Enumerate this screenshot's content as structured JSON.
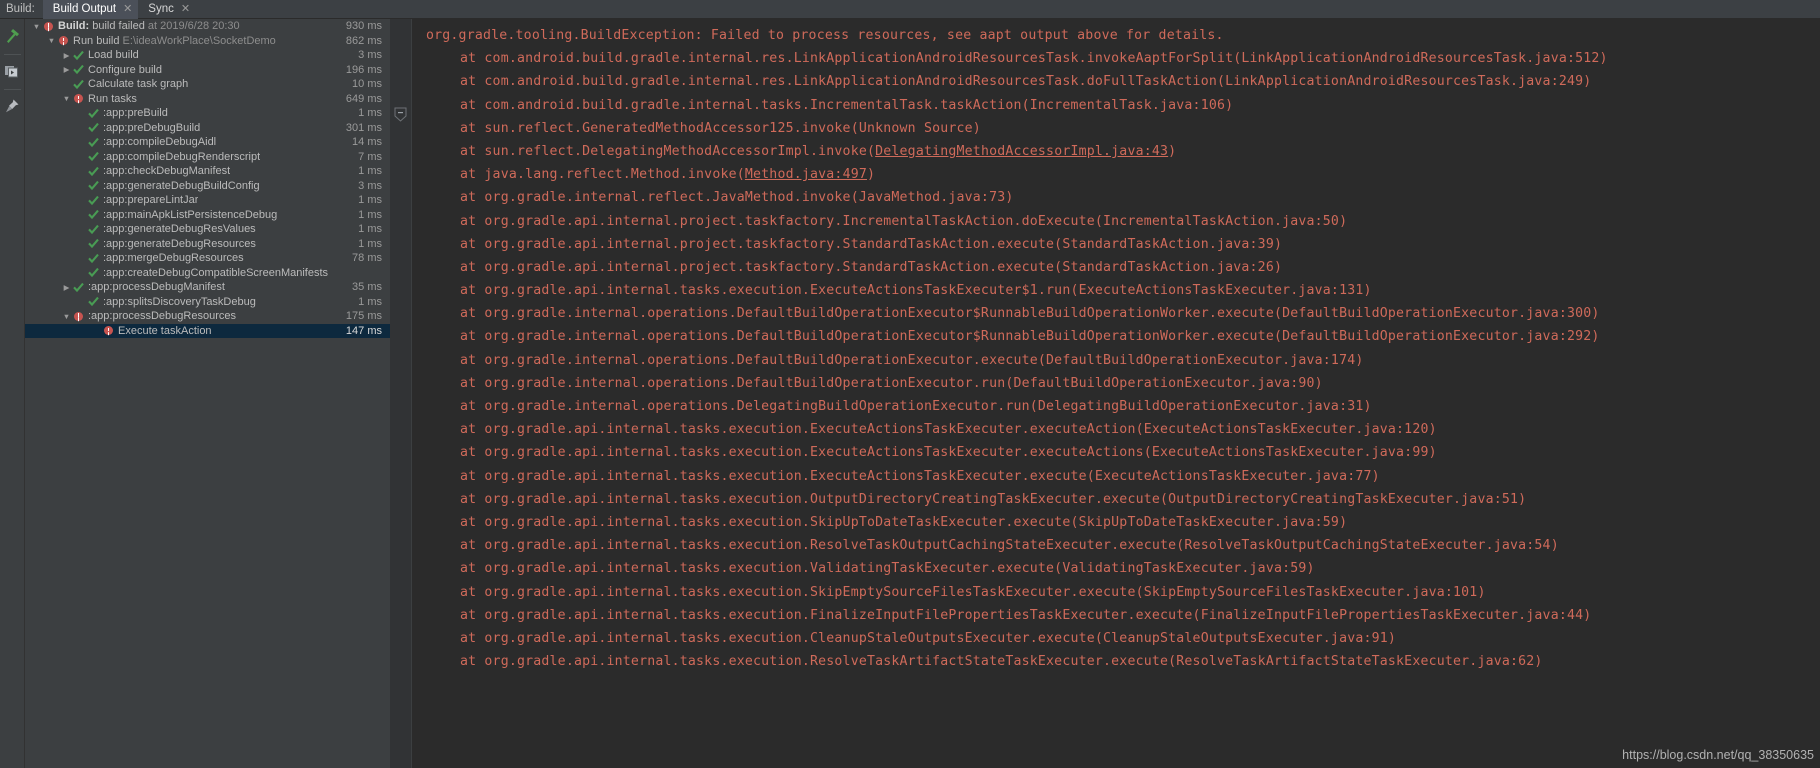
{
  "tabbar": {
    "build_label": "Build:",
    "tabs": [
      {
        "label": "Build Output",
        "close": "✕",
        "active": true
      },
      {
        "label": "Sync",
        "close": "✕",
        "active": false
      }
    ]
  },
  "left_toolbar": {
    "items": [
      {
        "icon": "hammer-icon",
        "name": "build-icon"
      },
      {
        "icon": "console-icon",
        "name": "show-console-icon"
      },
      {
        "icon": "pin-icon",
        "name": "pin-icon"
      }
    ]
  },
  "tree": {
    "rows": [
      {
        "indent": 0,
        "arrow": "▼",
        "icon": "error",
        "bold": "Build:",
        "text": " build failed ",
        "muted": "at 2019/6/28 20:30",
        "time": "930 ms",
        "selected": false
      },
      {
        "indent": 1,
        "arrow": "▼",
        "icon": "error",
        "bold": "",
        "text": "Run build ",
        "muted": "E:\\ideaWorkPlace\\SocketDemo",
        "time": "862 ms",
        "selected": false
      },
      {
        "indent": 2,
        "arrow": "▶",
        "icon": "check",
        "bold": "",
        "text": "Load build",
        "muted": "",
        "time": "3 ms",
        "selected": false
      },
      {
        "indent": 2,
        "arrow": "▶",
        "icon": "check",
        "bold": "",
        "text": "Configure build",
        "muted": "",
        "time": "196 ms",
        "selected": false
      },
      {
        "indent": 2,
        "arrow": "",
        "icon": "check",
        "bold": "",
        "text": "Calculate task graph",
        "muted": "",
        "time": "10 ms",
        "selected": false
      },
      {
        "indent": 2,
        "arrow": "▼",
        "icon": "error",
        "bold": "",
        "text": "Run tasks",
        "muted": "",
        "time": "649 ms",
        "selected": false
      },
      {
        "indent": 3,
        "arrow": "",
        "icon": "check",
        "bold": "",
        "text": ":app:preBuild",
        "muted": "",
        "time": "1 ms",
        "selected": false
      },
      {
        "indent": 3,
        "arrow": "",
        "icon": "check",
        "bold": "",
        "text": ":app:preDebugBuild",
        "muted": "",
        "time": "301 ms",
        "selected": false
      },
      {
        "indent": 3,
        "arrow": "",
        "icon": "check",
        "bold": "",
        "text": ":app:compileDebugAidl",
        "muted": "",
        "time": "14 ms",
        "selected": false
      },
      {
        "indent": 3,
        "arrow": "",
        "icon": "check",
        "bold": "",
        "text": ":app:compileDebugRenderscript",
        "muted": "",
        "time": "7 ms",
        "selected": false
      },
      {
        "indent": 3,
        "arrow": "",
        "icon": "check",
        "bold": "",
        "text": ":app:checkDebugManifest",
        "muted": "",
        "time": "1 ms",
        "selected": false
      },
      {
        "indent": 3,
        "arrow": "",
        "icon": "check",
        "bold": "",
        "text": ":app:generateDebugBuildConfig",
        "muted": "",
        "time": "3 ms",
        "selected": false
      },
      {
        "indent": 3,
        "arrow": "",
        "icon": "check",
        "bold": "",
        "text": ":app:prepareLintJar",
        "muted": "",
        "time": "1 ms",
        "selected": false
      },
      {
        "indent": 3,
        "arrow": "",
        "icon": "check",
        "bold": "",
        "text": ":app:mainApkListPersistenceDebug",
        "muted": "",
        "time": "1 ms",
        "selected": false
      },
      {
        "indent": 3,
        "arrow": "",
        "icon": "check",
        "bold": "",
        "text": ":app:generateDebugResValues",
        "muted": "",
        "time": "1 ms",
        "selected": false
      },
      {
        "indent": 3,
        "arrow": "",
        "icon": "check",
        "bold": "",
        "text": ":app:generateDebugResources",
        "muted": "",
        "time": "1 ms",
        "selected": false
      },
      {
        "indent": 3,
        "arrow": "",
        "icon": "check",
        "bold": "",
        "text": ":app:mergeDebugResources",
        "muted": "",
        "time": "78 ms",
        "selected": false
      },
      {
        "indent": 3,
        "arrow": "",
        "icon": "check",
        "bold": "",
        "text": ":app:createDebugCompatibleScreenManifests",
        "muted": "",
        "time": "",
        "selected": false
      },
      {
        "indent": 2,
        "arrow": "▶",
        "icon": "check",
        "bold": "",
        "text": ":app:processDebugManifest",
        "muted": "",
        "time": "35 ms",
        "selected": false
      },
      {
        "indent": 3,
        "arrow": "",
        "icon": "check",
        "bold": "",
        "text": ":app:splitsDiscoveryTaskDebug",
        "muted": "",
        "time": "1 ms",
        "selected": false
      },
      {
        "indent": 2,
        "arrow": "▼",
        "icon": "error",
        "bold": "",
        "text": ":app:processDebugResources",
        "muted": "",
        "time": "175 ms",
        "selected": false
      },
      {
        "indent": 4,
        "arrow": "",
        "icon": "error",
        "bold": "",
        "text": "Execute taskAction",
        "muted": "",
        "time": "147 ms",
        "selected": true
      }
    ]
  },
  "console": {
    "lines": [
      {
        "type": "head",
        "text": "org.gradle.tooling.BuildException: Failed to process resources, see aapt output above for details.",
        "link": ""
      },
      {
        "type": "tr",
        "text": "at com.android.build.gradle.internal.res.LinkApplicationAndroidResourcesTask.invokeAaptForSplit(LinkApplicationAndroidResourcesTask.java:512)",
        "link": ""
      },
      {
        "type": "tr",
        "text": "at com.android.build.gradle.internal.res.LinkApplicationAndroidResourcesTask.doFullTaskAction(LinkApplicationAndroidResourcesTask.java:249)",
        "link": ""
      },
      {
        "type": "tr",
        "text": "at com.android.build.gradle.internal.tasks.IncrementalTask.taskAction(IncrementalTask.java:106)",
        "link": ""
      },
      {
        "type": "tr",
        "text": "at sun.reflect.GeneratedMethodAccessor125.invoke(Unknown Source)",
        "link": ""
      },
      {
        "type": "tr",
        "text": "at sun.reflect.DelegatingMethodAccessorImpl.invoke(",
        "link": "DelegatingMethodAccessorImpl.java:43",
        "tail": ")"
      },
      {
        "type": "tr",
        "text": "at java.lang.reflect.Method.invoke(",
        "link": "Method.java:497",
        "tail": ")"
      },
      {
        "type": "tr",
        "text": "at org.gradle.internal.reflect.JavaMethod.invoke(JavaMethod.java:73)",
        "link": ""
      },
      {
        "type": "tr",
        "text": "at org.gradle.api.internal.project.taskfactory.IncrementalTaskAction.doExecute(IncrementalTaskAction.java:50)",
        "link": ""
      },
      {
        "type": "tr",
        "text": "at org.gradle.api.internal.project.taskfactory.StandardTaskAction.execute(StandardTaskAction.java:39)",
        "link": ""
      },
      {
        "type": "tr",
        "text": "at org.gradle.api.internal.project.taskfactory.StandardTaskAction.execute(StandardTaskAction.java:26)",
        "link": ""
      },
      {
        "type": "tr",
        "text": "at org.gradle.api.internal.tasks.execution.ExecuteActionsTaskExecuter$1.run(ExecuteActionsTaskExecuter.java:131)",
        "link": ""
      },
      {
        "type": "tr",
        "text": "at org.gradle.internal.operations.DefaultBuildOperationExecutor$RunnableBuildOperationWorker.execute(DefaultBuildOperationExecutor.java:300)",
        "link": ""
      },
      {
        "type": "tr",
        "text": "at org.gradle.internal.operations.DefaultBuildOperationExecutor$RunnableBuildOperationWorker.execute(DefaultBuildOperationExecutor.java:292)",
        "link": ""
      },
      {
        "type": "tr",
        "text": "at org.gradle.internal.operations.DefaultBuildOperationExecutor.execute(DefaultBuildOperationExecutor.java:174)",
        "link": ""
      },
      {
        "type": "tr",
        "text": "at org.gradle.internal.operations.DefaultBuildOperationExecutor.run(DefaultBuildOperationExecutor.java:90)",
        "link": ""
      },
      {
        "type": "tr",
        "text": "at org.gradle.internal.operations.DelegatingBuildOperationExecutor.run(DelegatingBuildOperationExecutor.java:31)",
        "link": ""
      },
      {
        "type": "tr",
        "text": "at org.gradle.api.internal.tasks.execution.ExecuteActionsTaskExecuter.executeAction(ExecuteActionsTaskExecuter.java:120)",
        "link": ""
      },
      {
        "type": "tr",
        "text": "at org.gradle.api.internal.tasks.execution.ExecuteActionsTaskExecuter.executeActions(ExecuteActionsTaskExecuter.java:99)",
        "link": ""
      },
      {
        "type": "tr",
        "text": "at org.gradle.api.internal.tasks.execution.ExecuteActionsTaskExecuter.execute(ExecuteActionsTaskExecuter.java:77)",
        "link": ""
      },
      {
        "type": "tr",
        "text": "at org.gradle.api.internal.tasks.execution.OutputDirectoryCreatingTaskExecuter.execute(OutputDirectoryCreatingTaskExecuter.java:51)",
        "link": ""
      },
      {
        "type": "tr",
        "text": "at org.gradle.api.internal.tasks.execution.SkipUpToDateTaskExecuter.execute(SkipUpToDateTaskExecuter.java:59)",
        "link": ""
      },
      {
        "type": "tr",
        "text": "at org.gradle.api.internal.tasks.execution.ResolveTaskOutputCachingStateExecuter.execute(ResolveTaskOutputCachingStateExecuter.java:54)",
        "link": ""
      },
      {
        "type": "tr",
        "text": "at org.gradle.api.internal.tasks.execution.ValidatingTaskExecuter.execute(ValidatingTaskExecuter.java:59)",
        "link": ""
      },
      {
        "type": "tr",
        "text": "at org.gradle.api.internal.tasks.execution.SkipEmptySourceFilesTaskExecuter.execute(SkipEmptySourceFilesTaskExecuter.java:101)",
        "link": ""
      },
      {
        "type": "tr",
        "text": "at org.gradle.api.internal.tasks.execution.FinalizeInputFilePropertiesTaskExecuter.execute(FinalizeInputFilePropertiesTaskExecuter.java:44)",
        "link": ""
      },
      {
        "type": "tr",
        "text": "at org.gradle.api.internal.tasks.execution.CleanupStaleOutputsExecuter.execute(CleanupStaleOutputsExecuter.java:91)",
        "link": ""
      },
      {
        "type": "tr",
        "text": "at org.gradle.api.internal.tasks.execution.ResolveTaskArtifactStateTaskExecuter.execute(ResolveTaskArtifactStateTaskExecuter.java:62)",
        "link": ""
      }
    ]
  },
  "watermark": {
    "text": "https://blog.csdn.net/qq_38350635"
  },
  "colors": {
    "error_red": "#c75450",
    "console_text": "#cf6a5a",
    "check_green": "#499c54",
    "selection": "#0d293e",
    "panel_bg": "#3c3f41",
    "console_bg": "#2b2b2b"
  }
}
